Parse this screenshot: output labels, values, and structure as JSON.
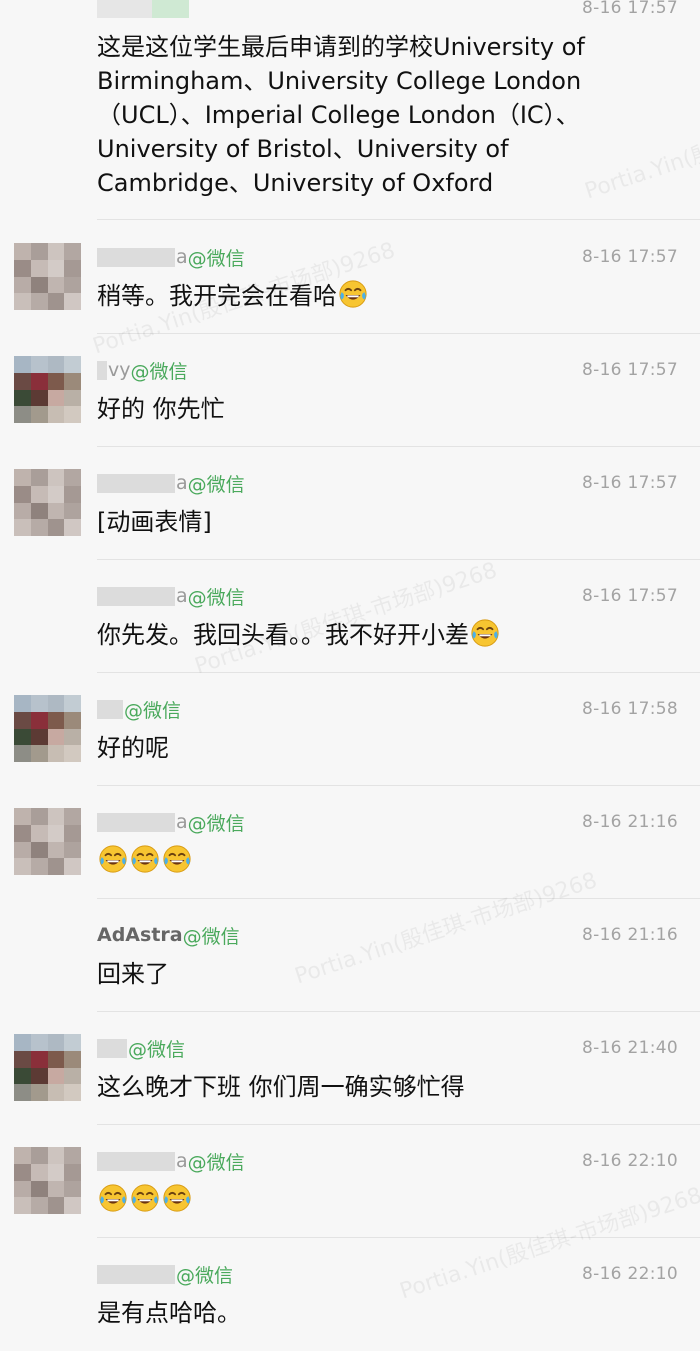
{
  "chat": {
    "first_message": {
      "time": "8-16 17:57",
      "lines": [
        "这是这位学生最后申请到的学校University of",
        "Birmingham、University College London",
        "（UCL）、Imperial College London（IC）、",
        "University of Bristol、University of",
        "Cambridge、University of Oxford"
      ]
    },
    "messages": [
      {
        "sender_tail": "a",
        "at": "@微信",
        "time": "8-16 17:57",
        "text": "稍等。我开完会在看哈",
        "emoji_count": 1
      },
      {
        "sender_tail": "vy",
        "at": "@微信",
        "time": "8-16 17:57",
        "text": "好的 你先忙",
        "emoji_count": 0
      },
      {
        "sender_tail": "a",
        "at": "@微信",
        "time": "8-16 17:57",
        "text": "[动画表情]",
        "emoji_count": 0
      },
      {
        "sender_tail": "a",
        "at": "@微信",
        "time": "8-16 17:57",
        "text": "你先发。我回头看。。我不好开小差",
        "emoji_count": 1
      },
      {
        "sender_tail": "",
        "at": "@微信",
        "time": "8-16 17:58",
        "text": "好的呢",
        "emoji_count": 0
      },
      {
        "sender_tail": "a",
        "at": "@微信",
        "time": "8-16 21:16",
        "text": "",
        "emoji_count": 3
      },
      {
        "sender_name": "AdAstra",
        "at": "@微信",
        "time": "8-16 21:16",
        "text": "回来了",
        "emoji_count": 0
      },
      {
        "sender_tail": "",
        "at": "@微信",
        "time": "8-16 21:40",
        "text": "这么晚才下班 你们周一确实够忙得",
        "emoji_count": 0
      },
      {
        "sender_tail": "a",
        "at": "@微信",
        "time": "8-16 22:10",
        "text": "",
        "emoji_count": 3
      },
      {
        "sender_tail": "",
        "at": "@微信",
        "time": "8-16 22:10",
        "text": "是有点哈哈。",
        "emoji_count": 0
      }
    ]
  },
  "watermark": {
    "text": "Portia.Yin(殷佳琪-市场部)9268"
  },
  "colors": {
    "background": "#f7f7f7",
    "sender_green": "#4aa95c",
    "time_gray": "#a3a3a3",
    "divider": "#e3e3e3"
  },
  "icons": {
    "emoji": "laughing-crying-emoji-icon"
  }
}
